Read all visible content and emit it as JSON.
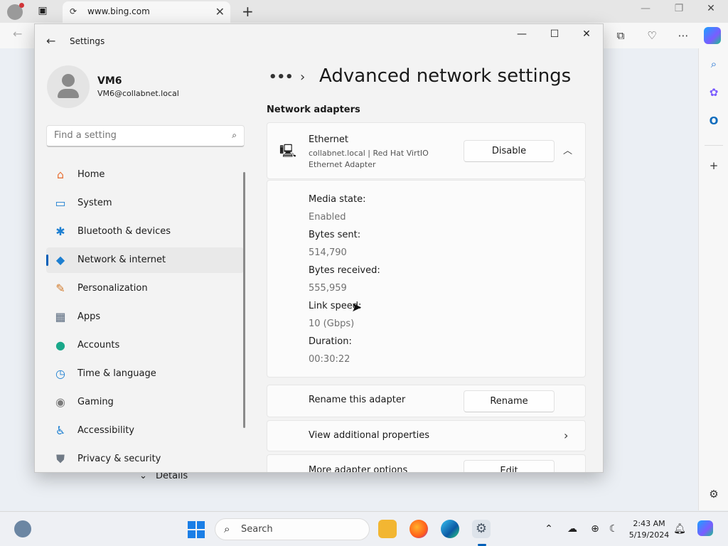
{
  "browser": {
    "tab_title": "www.bing.com",
    "tab_close": "✕",
    "new_tab": "+",
    "minimize": "—",
    "restore": "❐",
    "close": "✕"
  },
  "settings": {
    "window_title": "Settings",
    "user": {
      "name": "VM6",
      "email": "VM6@collabnet.local"
    },
    "search_placeholder": "Find a setting",
    "nav": [
      {
        "label": "Home",
        "icon": "home-icon",
        "glyph": "⌂",
        "color": "#e8733a"
      },
      {
        "label": "System",
        "icon": "monitor-icon",
        "glyph": "▭",
        "color": "#1d7fd1"
      },
      {
        "label": "Bluetooth & devices",
        "icon": "bluetooth-icon",
        "glyph": "✱",
        "color": "#1d7fd1"
      },
      {
        "label": "Network & internet",
        "icon": "wifi-icon",
        "glyph": "◆",
        "color": "#1d7fd1"
      },
      {
        "label": "Personalization",
        "icon": "brush-icon",
        "glyph": "✎",
        "color": "#d27b2c"
      },
      {
        "label": "Apps",
        "icon": "apps-icon",
        "glyph": "▦",
        "color": "#5a6b7f"
      },
      {
        "label": "Accounts",
        "icon": "person-icon",
        "glyph": "●",
        "color": "#1aa88a"
      },
      {
        "label": "Time & language",
        "icon": "globe-clock-icon",
        "glyph": "◷",
        "color": "#1d7fd1"
      },
      {
        "label": "Gaming",
        "icon": "gamepad-icon",
        "glyph": "◉",
        "color": "#7a7a7a"
      },
      {
        "label": "Accessibility",
        "icon": "accessibility-icon",
        "glyph": "♿",
        "color": "#1d7fd1"
      },
      {
        "label": "Privacy & security",
        "icon": "shield-icon",
        "glyph": "⛊",
        "color": "#707a86"
      }
    ],
    "active_nav": "Network & internet",
    "breadcrumb_more": "•••",
    "breadcrumb_sep": "›",
    "page_title": "Advanced network settings",
    "section_title": "Network adapters",
    "adapter": {
      "name": "Ethernet",
      "description": "collabnet.local | Red Hat VirtIO Ethernet Adapter",
      "disable_label": "Disable",
      "properties": [
        {
          "label": "Media state:",
          "value": "Enabled"
        },
        {
          "label": "Bytes sent:",
          "value": "514,790"
        },
        {
          "label": "Bytes received:",
          "value": "555,959"
        },
        {
          "label": "Link speed:",
          "value": "10 (Gbps)"
        },
        {
          "label": "Duration:",
          "value": "00:30:22"
        }
      ],
      "rename_label": "Rename this adapter",
      "rename_button": "Rename",
      "view_properties": "View additional properties",
      "more_options": "More adapter options",
      "edit_button": "Edit"
    }
  },
  "behind": {
    "details_label": "Details"
  },
  "taskbar": {
    "search_placeholder": "Search",
    "time": "2:43 AM",
    "date": "5/19/2024"
  }
}
